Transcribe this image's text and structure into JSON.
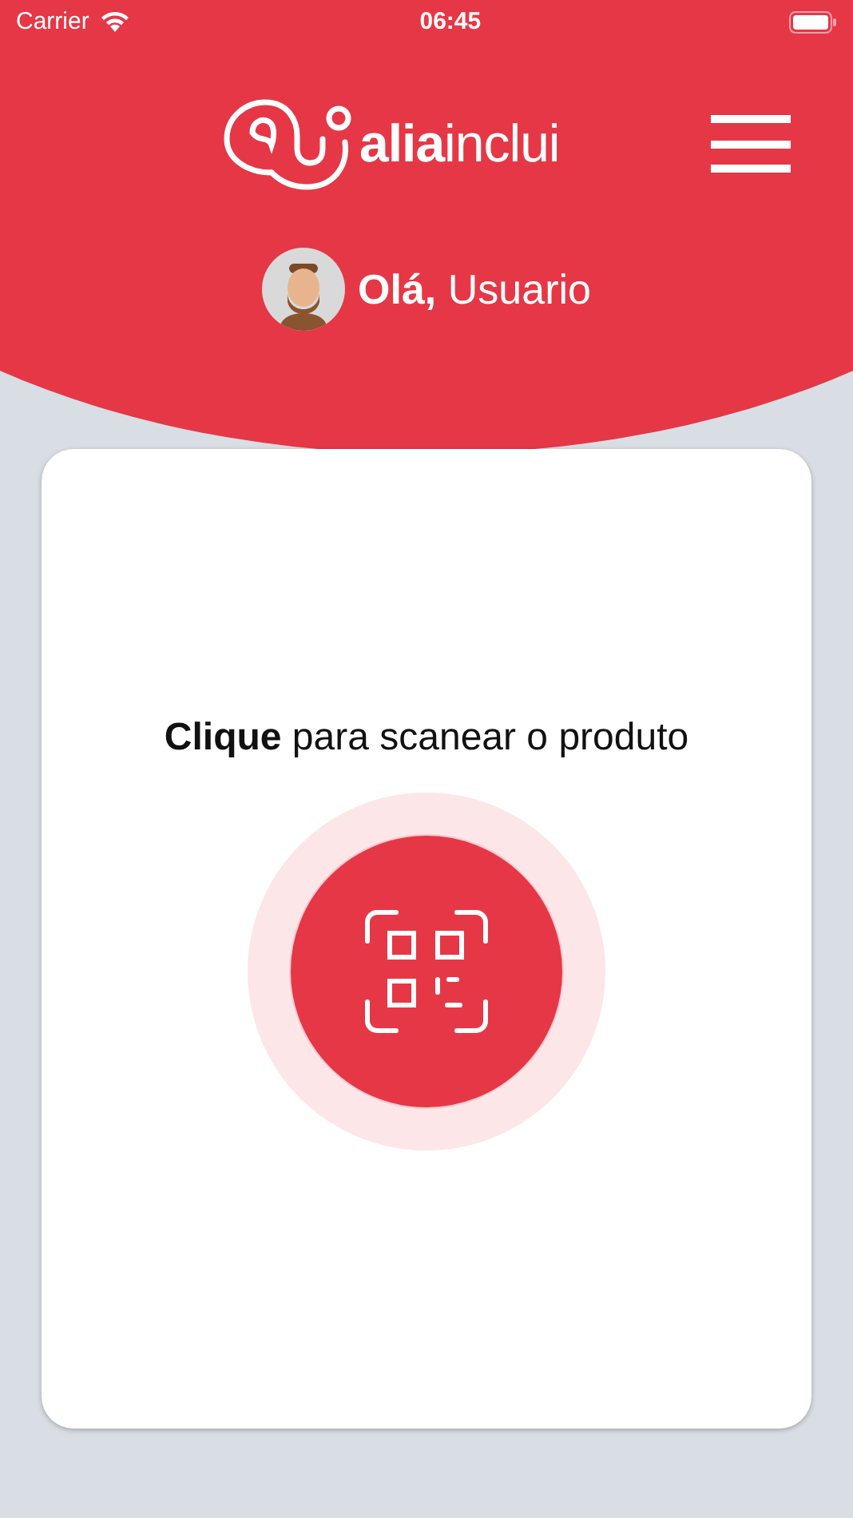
{
  "status_bar": {
    "carrier": "Carrier",
    "time": "06:45"
  },
  "header": {
    "logo": "**alia**inclui",
    "greeting": "**Olá,** Usuario"
  },
  "scan_card": {
    "prompt": "**Clique** para scanear o produto"
  }
}
